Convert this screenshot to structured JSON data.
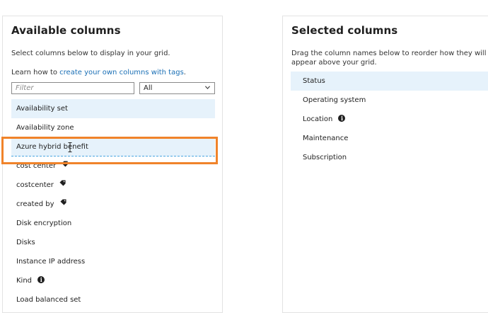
{
  "available": {
    "title": "Available columns",
    "description": "Select columns below to display in your grid.",
    "learn_prefix": "Learn how to ",
    "learn_link": "create your own columns with tags",
    "learn_suffix": ".",
    "filter_placeholder": "Filter",
    "type_select_value": "All",
    "items": [
      {
        "label": "Availability set"
      },
      {
        "label": "Availability zone"
      },
      {
        "label": "Azure hybrid benefit"
      },
      {
        "label": "cost center",
        "icon": "tag-icon"
      },
      {
        "label": "costcenter",
        "icon": "tag-icon"
      },
      {
        "label": "created by",
        "icon": "tag-icon"
      },
      {
        "label": "Disk encryption"
      },
      {
        "label": "Disks"
      },
      {
        "label": "Instance IP address"
      },
      {
        "label": "Kind",
        "icon": "info-icon"
      },
      {
        "label": "Load balanced set"
      }
    ]
  },
  "selected": {
    "title": "Selected columns",
    "description_line1": "Drag the column names below to reorder how they will",
    "description_line2": "appear above your grid.",
    "items": [
      {
        "label": "Status"
      },
      {
        "label": "Operating system"
      },
      {
        "label": "Location",
        "icon": "info-icon"
      },
      {
        "label": "Maintenance"
      },
      {
        "label": "Subscription"
      }
    ]
  },
  "colors": {
    "accent_link": "#1a6fb5",
    "row_highlight": "#e6f2fb",
    "callout_border": "#f0832a"
  }
}
